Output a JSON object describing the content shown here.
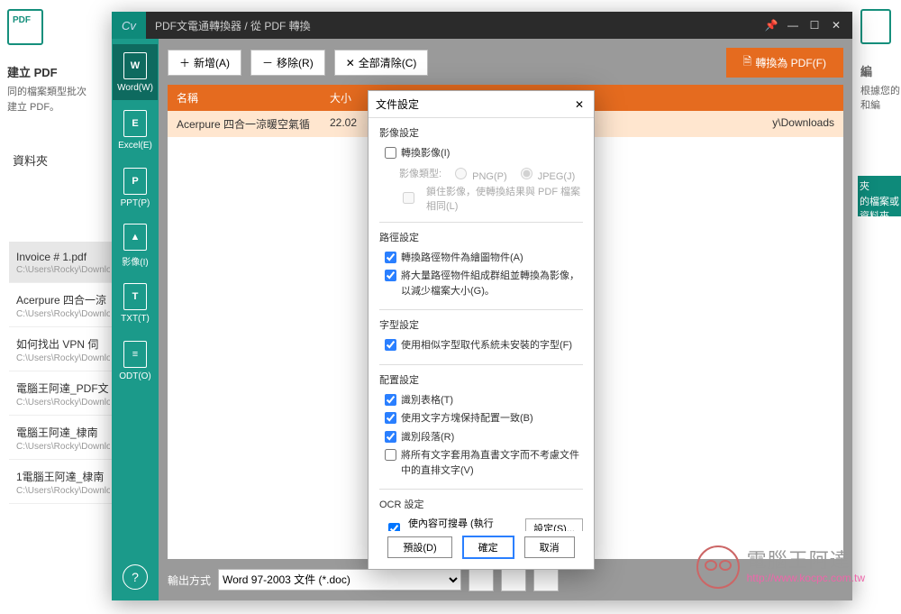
{
  "bg_left": {
    "create_pdf": "建立 PDF",
    "desc1": "同的檔案類型批次",
    "desc2": "建立 PDF。",
    "folder": "資料夾"
  },
  "bg_right": {
    "edit": "編",
    "desc_line": "根據您的",
    "desc_line2": "和編",
    "green_l1": "夾",
    "green_l2": "的檔案或資料夾"
  },
  "files": [
    {
      "name": "Invoice # 1.pdf",
      "path": "C:\\Users\\Rocky\\Downlo"
    },
    {
      "name": "Acerpure 四合一涼",
      "path": "C:\\Users\\Rocky\\Downlo"
    },
    {
      "name": "如何找出 VPN 伺",
      "path": "C:\\Users\\Rocky\\Downlo"
    },
    {
      "name": "電腦王阿達_PDF文",
      "path": "C:\\Users\\Rocky\\Downlo"
    },
    {
      "name": "電腦王阿達_棣南",
      "path": "C:\\Users\\Rocky\\Downlo"
    },
    {
      "name": "1電腦王阿達_棣南",
      "path": "C:\\Users\\Rocky\\Downlo"
    }
  ],
  "titlebar": {
    "title": "PDF文電通轉換器 / 從 PDF 轉換",
    "logo": "Cv"
  },
  "formats": [
    {
      "id": "word",
      "letter": "W",
      "label": "Word(W)"
    },
    {
      "id": "excel",
      "letter": "E",
      "label": "Excel(E)"
    },
    {
      "id": "ppt",
      "letter": "P",
      "label": "PPT(P)"
    },
    {
      "id": "image",
      "letter": "",
      "label": "影像(I)"
    },
    {
      "id": "txt",
      "letter": "T",
      "label": "TXT(T)"
    },
    {
      "id": "odt",
      "letter": "",
      "label": "ODT(O)"
    }
  ],
  "toolbar": {
    "add": "新增(A)",
    "remove": "移除(R)",
    "clear": "全部清除(C)",
    "convert": "轉換為 PDF(F)"
  },
  "table": {
    "col_name": "名稱",
    "col_size": "大小",
    "row_name": "Acerpure 四合一涼暖空氣循",
    "row_size": "22.02",
    "row_path": "y\\Downloads"
  },
  "footer": {
    "label": "輸出方式",
    "format": "Word 97-2003 文件 (*.doc)"
  },
  "dialog": {
    "title": "文件設定",
    "image_section": "影像設定",
    "opt_convert_image": "轉換影像(I)",
    "image_type_label": "影像類型:",
    "png": "PNG(P)",
    "jpeg": "JPEG(J)",
    "lock_images": "鎖住影像，使轉換結果與 PDF 檔案相同(L)",
    "path_section": "路徑設定",
    "opt_path1": "轉換路徑物件為繪圖物件(A)",
    "opt_path2": "將大量路徑物件組成群組並轉換為影像，以減少檔案大小(G)。",
    "font_section": "字型設定",
    "opt_font": "使用相似字型取代系統未安裝的字型(F)",
    "layout_section": "配置設定",
    "opt_table": "識別表格(T)",
    "opt_textbox": "使用文字方塊保持配置一致(B)",
    "opt_para": "識別段落(R)",
    "opt_vertical": "將所有文字套用為直書文字而不考慮文件中的直排文字(V)",
    "ocr_section": "OCR 設定",
    "opt_ocr": "使內容可搜尋 (執行 OCR)(U)",
    "ocr_settings_btn": "設定(S)...",
    "btn_default": "預設(D)",
    "btn_ok": "確定",
    "btn_cancel": "取消"
  },
  "watermark": {
    "name": "電腦王阿達",
    "url": "http://www.kocpc.com.tw"
  }
}
